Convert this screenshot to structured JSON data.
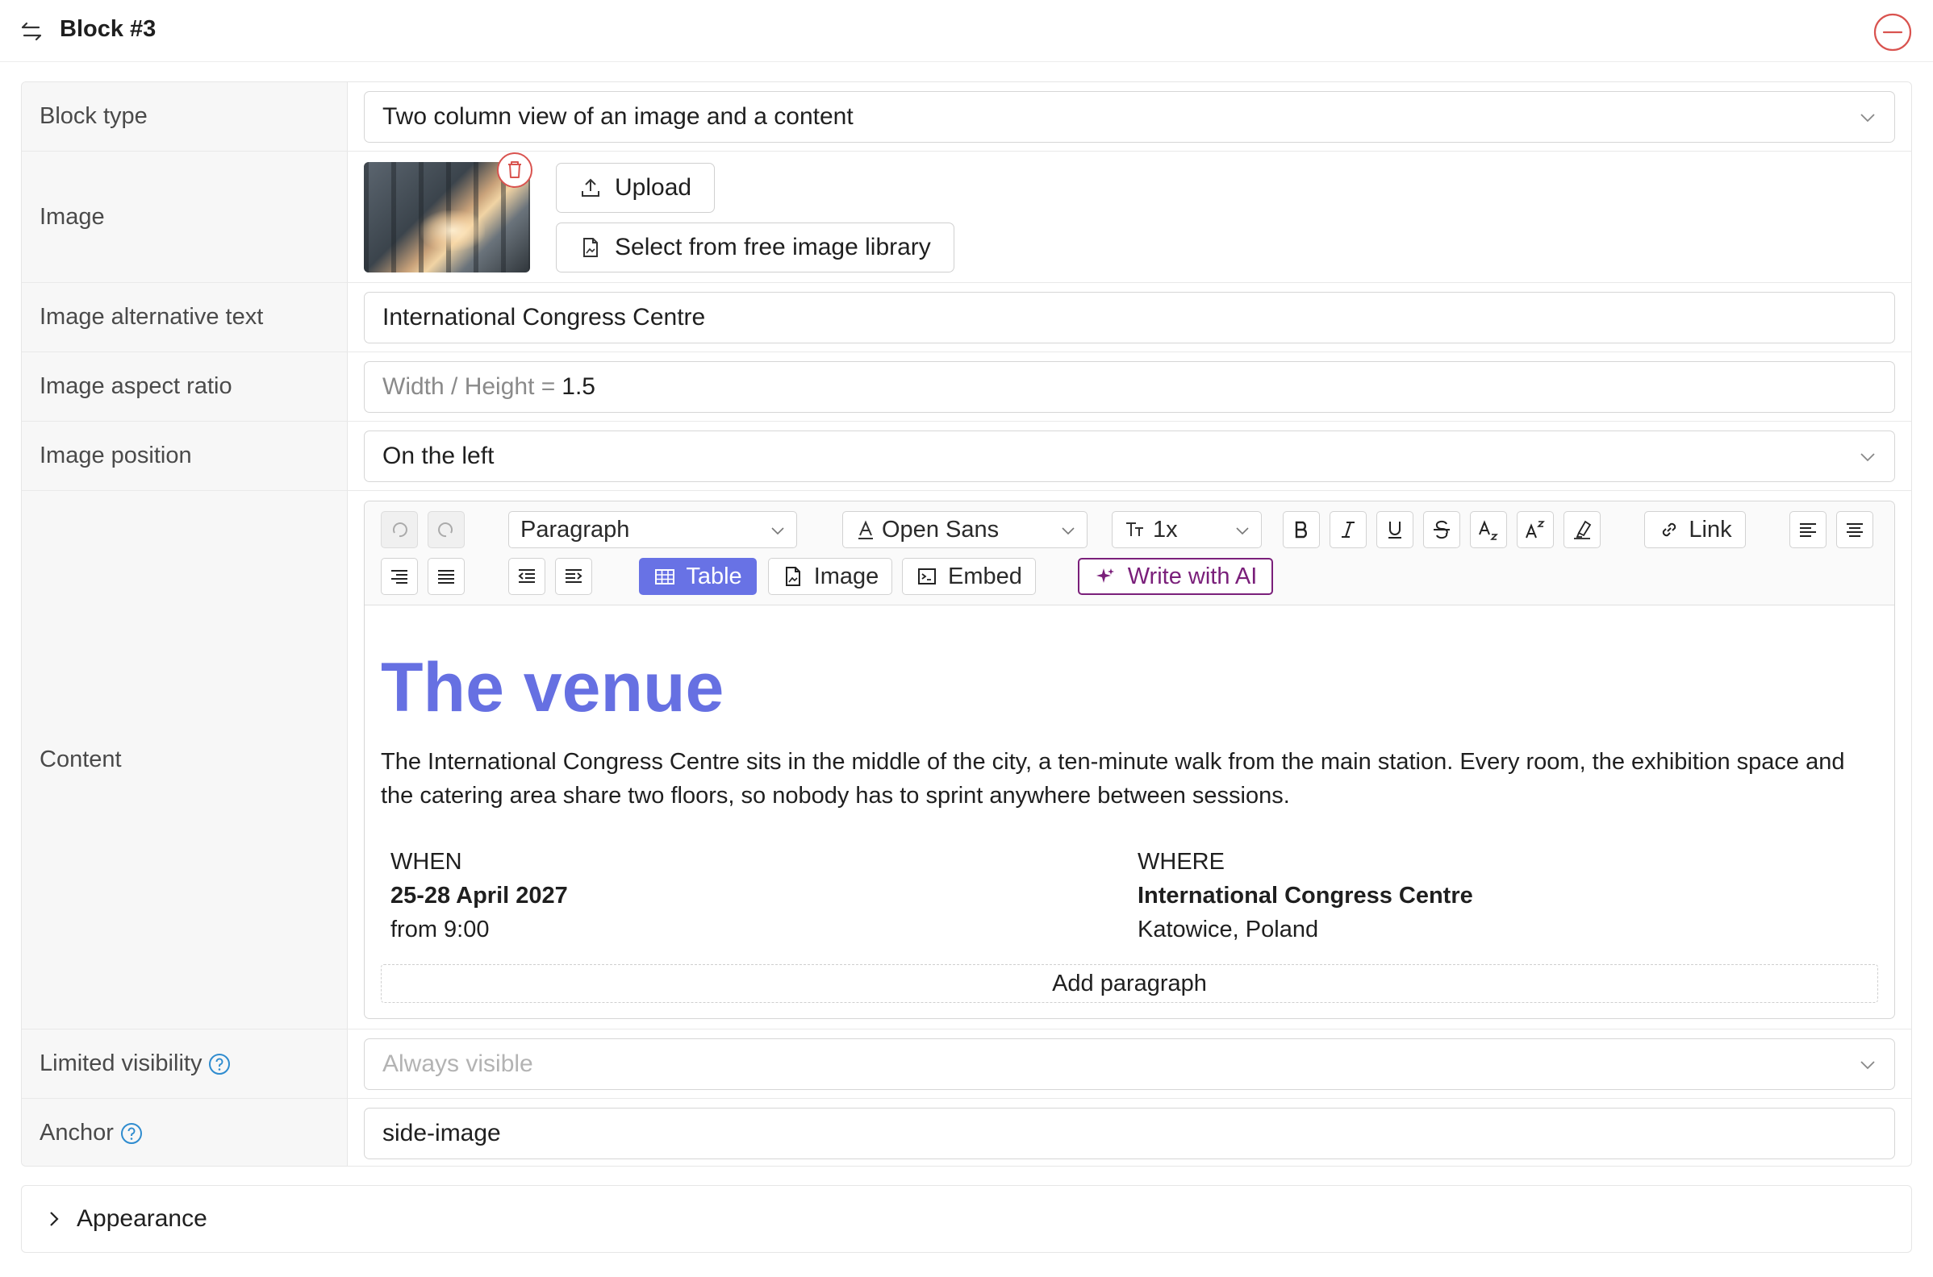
{
  "header": {
    "title": "Block #3"
  },
  "form": {
    "block_type": {
      "label": "Block type",
      "value": "Two column view of an image and a content"
    },
    "image": {
      "label": "Image",
      "upload_label": "Upload",
      "library_label": "Select from free image library"
    },
    "alt_text": {
      "label": "Image alternative text",
      "value": "International Congress Centre"
    },
    "aspect_ratio": {
      "label": "Image aspect ratio",
      "prefix": "Width / Height =",
      "value": "1.5"
    },
    "position": {
      "label": "Image position",
      "value": "On the left"
    },
    "content": {
      "label": "Content",
      "toolbar": {
        "paragraph": "Paragraph",
        "font": "Open Sans",
        "size": "1x",
        "link": "Link",
        "table": "Table",
        "image": "Image",
        "embed": "Embed",
        "ai": "Write with AI"
      },
      "heading": "The venue",
      "paragraph": "The International Congress Centre sits in the middle of the city, a ten-minute walk from the main station. Every room, the exhibition space and the catering area share two floors, so nobody has to sprint anywhere between sessions.",
      "when": {
        "title": "WHEN",
        "date": "25-28 April 2027",
        "time": "from 9:00"
      },
      "where": {
        "title": "WHERE",
        "venue": "International Congress Centre",
        "city": "Katowice, Poland"
      },
      "add_paragraph": "Add paragraph"
    },
    "visibility": {
      "label": "Limited visibility",
      "placeholder": "Always visible"
    },
    "anchor": {
      "label": "Anchor",
      "value": "side-image"
    }
  },
  "appearance": {
    "label": "Appearance"
  },
  "colors": {
    "accent": "#6872e5",
    "heading": "#6670e2",
    "ai": "#7a1f7a",
    "danger": "#d9534f",
    "help": "#2f8ccf"
  }
}
